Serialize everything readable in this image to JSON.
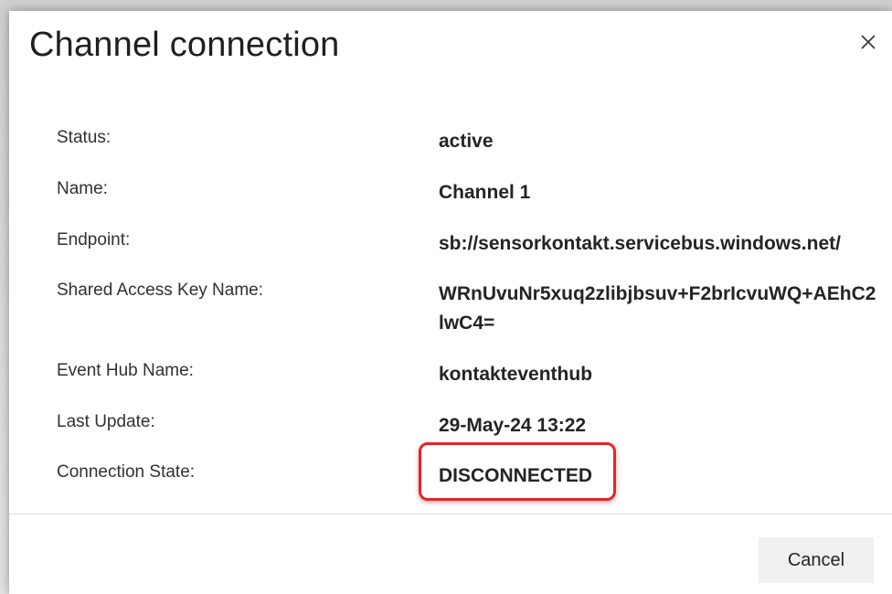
{
  "dialog": {
    "title": "Channel connection",
    "close_icon": "close-icon",
    "fields": {
      "status": {
        "label": "Status:",
        "value": "active"
      },
      "name": {
        "label": "Name:",
        "value": "Channel 1"
      },
      "endpoint": {
        "label": "Endpoint:",
        "value": "sb://sensorkontakt.servicebus.windows.net/"
      },
      "shared_access_key_name": {
        "label": "Shared Access Key Name:",
        "value": "WRnUvuNr5xuq2zlibjbsuv+F2brIcvuWQ+AEhC2lwC4="
      },
      "event_hub_name": {
        "label": "Event Hub Name:",
        "value": "kontakteventhub"
      },
      "last_update": {
        "label": "Last Update:",
        "value": "29-May-24 13:22"
      },
      "connection_state": {
        "label": "Connection State:",
        "value": "DISCONNECTED"
      }
    },
    "cancel_label": "Cancel",
    "highlight_color": "#e0262b"
  }
}
